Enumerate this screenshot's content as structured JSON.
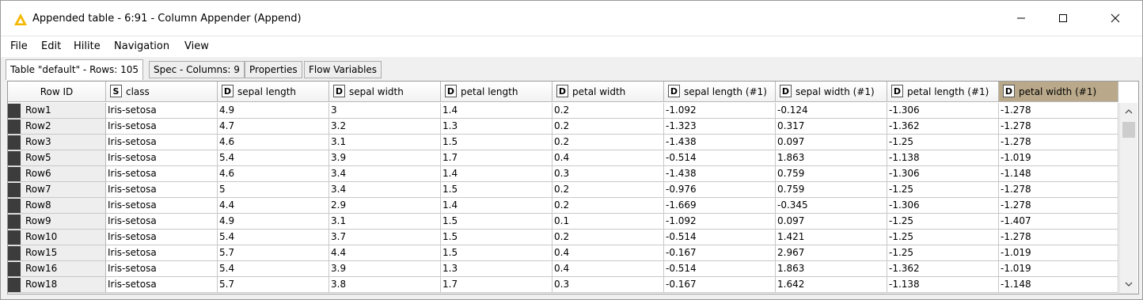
{
  "window": {
    "title": "Appended table - 6:91 - Column Appender (Append)",
    "warning_color": "#f5b800"
  },
  "menu": [
    "File",
    "Edit",
    "Hilite",
    "Navigation",
    "View"
  ],
  "tabs": [
    "Table \"default\" - Rows: 105",
    "Spec - Columns: 9",
    "Properties",
    "Flow Variables"
  ],
  "table": {
    "rowid_header": "Row ID",
    "columns": [
      {
        "type": "S",
        "name": "class"
      },
      {
        "type": "D",
        "name": "sepal length"
      },
      {
        "type": "D",
        "name": "sepal width"
      },
      {
        "type": "D",
        "name": "petal length"
      },
      {
        "type": "D",
        "name": "petal width"
      },
      {
        "type": "D",
        "name": "sepal length (#1)"
      },
      {
        "type": "D",
        "name": "sepal width (#1)"
      },
      {
        "type": "D",
        "name": "petal length (#1)"
      },
      {
        "type": "D",
        "name": "petal width (#1)"
      }
    ],
    "rows": [
      {
        "id": "Row1",
        "cells": [
          "Iris-setosa",
          "4.9",
          "3",
          "1.4",
          "0.2",
          "-1.092",
          "-0.124",
          "-1.306",
          "-1.278"
        ]
      },
      {
        "id": "Row2",
        "cells": [
          "Iris-setosa",
          "4.7",
          "3.2",
          "1.3",
          "0.2",
          "-1.323",
          "0.317",
          "-1.362",
          "-1.278"
        ]
      },
      {
        "id": "Row3",
        "cells": [
          "Iris-setosa",
          "4.6",
          "3.1",
          "1.5",
          "0.2",
          "-1.438",
          "0.097",
          "-1.25",
          "-1.278"
        ]
      },
      {
        "id": "Row5",
        "cells": [
          "Iris-setosa",
          "5.4",
          "3.9",
          "1.7",
          "0.4",
          "-0.514",
          "1.863",
          "-1.138",
          "-1.019"
        ]
      },
      {
        "id": "Row6",
        "cells": [
          "Iris-setosa",
          "4.6",
          "3.4",
          "1.4",
          "0.3",
          "-1.438",
          "0.759",
          "-1.306",
          "-1.148"
        ]
      },
      {
        "id": "Row7",
        "cells": [
          "Iris-setosa",
          "5",
          "3.4",
          "1.5",
          "0.2",
          "-0.976",
          "0.759",
          "-1.25",
          "-1.278"
        ]
      },
      {
        "id": "Row8",
        "cells": [
          "Iris-setosa",
          "4.4",
          "2.9",
          "1.4",
          "0.2",
          "-1.669",
          "-0.345",
          "-1.306",
          "-1.278"
        ]
      },
      {
        "id": "Row9",
        "cells": [
          "Iris-setosa",
          "4.9",
          "3.1",
          "1.5",
          "0.1",
          "-1.092",
          "0.097",
          "-1.25",
          "-1.407"
        ]
      },
      {
        "id": "Row10",
        "cells": [
          "Iris-setosa",
          "5.4",
          "3.7",
          "1.5",
          "0.2",
          "-0.514",
          "1.421",
          "-1.25",
          "-1.278"
        ]
      },
      {
        "id": "Row15",
        "cells": [
          "Iris-setosa",
          "5.7",
          "4.4",
          "1.5",
          "0.4",
          "-0.167",
          "2.967",
          "-1.25",
          "-1.019"
        ]
      },
      {
        "id": "Row16",
        "cells": [
          "Iris-setosa",
          "5.4",
          "3.9",
          "1.3",
          "0.4",
          "-0.514",
          "1.863",
          "-1.362",
          "-1.019"
        ]
      },
      {
        "id": "Row18",
        "cells": [
          "Iris-setosa",
          "5.7",
          "3.8",
          "1.7",
          "0.3",
          "-0.167",
          "1.642",
          "-1.138",
          "-1.148"
        ]
      }
    ]
  },
  "highlight_color": "#b9a98a"
}
